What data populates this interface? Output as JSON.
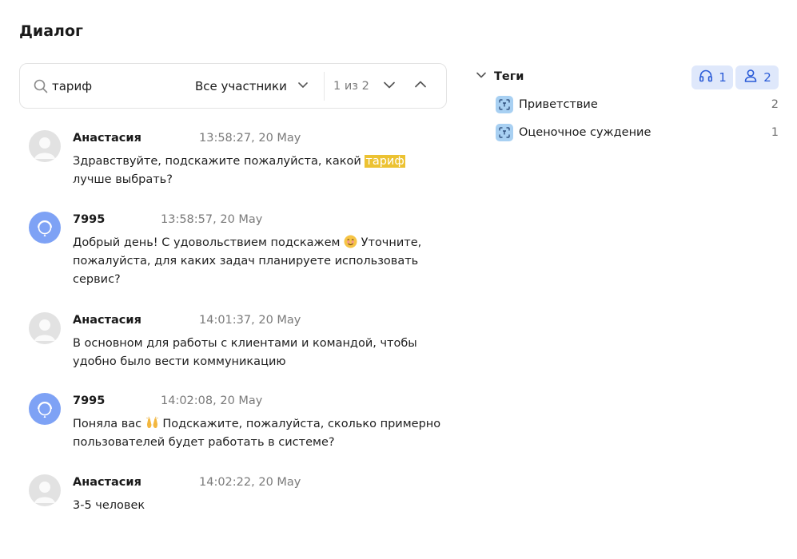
{
  "page": {
    "title": "Диалог"
  },
  "search": {
    "query": "тариф",
    "participants_filter": "Все участники",
    "match_counter": "1 из 2"
  },
  "messages": [
    {
      "author": "Анастасия",
      "role": "client",
      "time": "13:58:27, 20 May",
      "text_before": "Здравствуйте, подскажите пожалуйста, какой ",
      "highlight": "тариф",
      "text_after": " лучше выбрать?"
    },
    {
      "author": "7995",
      "role": "operator",
      "time": "13:58:57, 20 May",
      "text_before": "Добрый день! С удовольствием подскажем",
      "emoji": "smiling-face-emoji",
      "text_after": " Уточните, пожалуйста, для каких задач планируете использовать сервис?"
    },
    {
      "author": "Анастасия",
      "role": "client",
      "time": "14:01:37, 20 May",
      "text": "В основном для работы с клиентами и командой, чтобы удобно было вести коммуникацию"
    },
    {
      "author": "7995",
      "role": "operator",
      "time": "14:02:08, 20 May",
      "text_before": "Поняла вас",
      "emoji": "raised-hands-emoji",
      "text_after": " Подскажите, пожалуйста, сколько примерно пользователей будет работать в системе?"
    },
    {
      "author": "Анастасия",
      "role": "client",
      "time": "14:02:22, 20 May",
      "text": "3-5 человек"
    }
  ],
  "tags": {
    "title": "Теги",
    "operator_count": "1",
    "client_count": "2",
    "items": [
      {
        "label": "Приветствие",
        "count": "2"
      },
      {
        "label": "Оценочное суждение",
        "count": "1"
      }
    ]
  },
  "colors": {
    "highlight": "#ecc232",
    "badge_bg": "#dfe8fb",
    "badge_fg": "#2a5bd7",
    "operator_avatar": "#7ea2f5",
    "tag_icon_bg": "#a8d0f2"
  }
}
